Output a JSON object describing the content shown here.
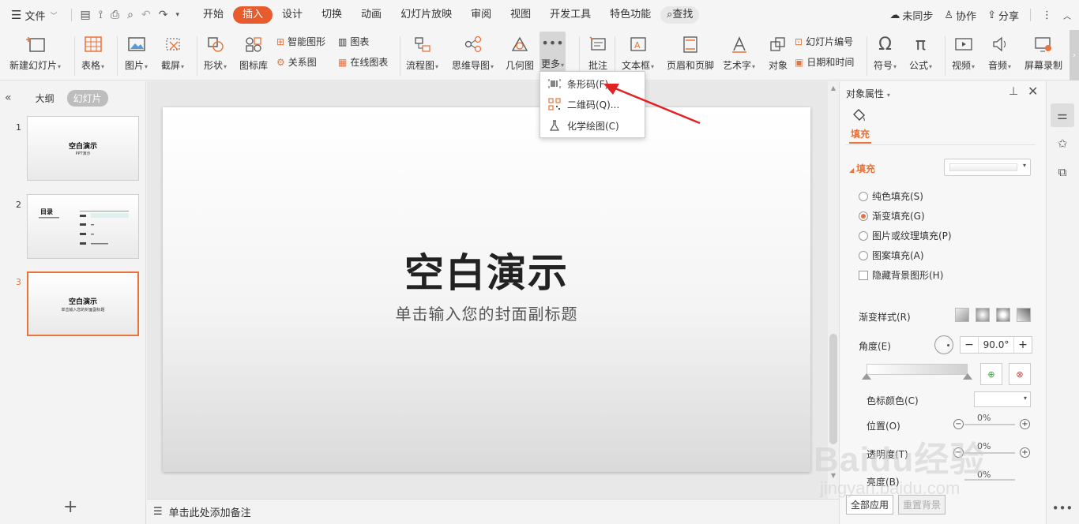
{
  "menubar": {
    "file_label": "文件",
    "tabs": [
      "开始",
      "插入",
      "设计",
      "切换",
      "动画",
      "幻灯片放映",
      "审阅",
      "视图",
      "开发工具",
      "特色功能"
    ],
    "search_label": "查找",
    "sync_label": "未同步",
    "collab_label": "协作",
    "share_label": "分享"
  },
  "ribbon": {
    "new_slide": "新建幻灯片",
    "table": "表格",
    "picture": "图片",
    "screenshot": "截屏",
    "shape": "形状",
    "icon_lib": "图标库",
    "smart_art": "智能图形",
    "chart": "图表",
    "relation": "关系图",
    "online_chart": "在线图表",
    "flowchart": "流程图",
    "mindmap": "思维导图",
    "geometry": "几何图",
    "more": "更多",
    "comment": "批注",
    "textbox": "文本框",
    "header_footer": "页眉和页脚",
    "wordart": "艺术字",
    "object": "对象",
    "slide_number": "幻灯片编号",
    "datetime": "日期和时间",
    "symbol": "符号",
    "formula": "公式",
    "video": "视频",
    "audio": "音频",
    "screen_record": "屏幕录制"
  },
  "dropdown": {
    "barcode": "条形码(F)",
    "qrcode": "二维码(Q)...",
    "chem": "化学绘图(C)"
  },
  "leftpane": {
    "outline_tab": "大纲",
    "slides_tab": "幻灯片",
    "slides": [
      {
        "num": "1",
        "title": "空白演示",
        "sub": "PPT演示"
      },
      {
        "num": "2",
        "title": "目录",
        "sub": ""
      },
      {
        "num": "3",
        "title": "空白演示",
        "sub": "单击输入您的封面副标题"
      }
    ]
  },
  "slide": {
    "title": "空白演示",
    "subtitle": "单击输入您的封面副标题"
  },
  "notes": {
    "placeholder": "单击此处添加备注"
  },
  "props": {
    "title": "对象属性",
    "fill_tab": "填充",
    "fill_section": "填充",
    "solid": "纯色填充(S)",
    "gradient": "渐变填充(G)",
    "picture_texture": "图片或纹理填充(P)",
    "pattern": "图案填充(A)",
    "hide_bg": "隐藏背景图形(H)",
    "gradient_style": "渐变样式(R)",
    "angle_label": "角度(E)",
    "angle_value": "90.0°",
    "stop_color": "色标颜色(C)",
    "position": "位置(O)",
    "position_pct": "0%",
    "transparency": "透明度(T)",
    "transparency_pct": "0%",
    "brightness": "亮度(B)",
    "brightness_pct": "0%",
    "apply_all": "全部应用",
    "reset_bg": "重置背景"
  },
  "watermark": {
    "brand": "Baidu经验",
    "url": "jingyan.baidu.com"
  },
  "colors": {
    "accent": "#e8743b",
    "active_tab": "#e85b2c",
    "annotation": "#e02424"
  }
}
